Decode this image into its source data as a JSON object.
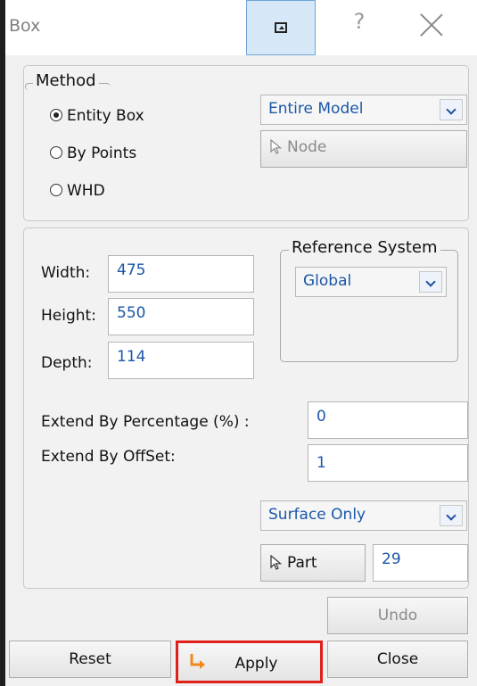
{
  "window": {
    "title": "Box",
    "help_glyph": "?"
  },
  "method": {
    "legend": "Method",
    "options": [
      "Entity Box",
      "By Points",
      "WHD"
    ],
    "selected": "Entity Box",
    "scope_combo": "Entire Model",
    "node_button": "Node"
  },
  "dimensions": {
    "width_label": "Width:",
    "width_value": "475",
    "height_label": "Height:",
    "height_value": "550",
    "depth_label": "Depth:",
    "depth_value": "114"
  },
  "reference_system": {
    "legend": "Reference System",
    "value": "Global"
  },
  "extend": {
    "percentage_label": "Extend By Percentage (%) :",
    "percentage_value": "0",
    "offset_label": "Extend By OffSet:",
    "offset_value": "1"
  },
  "surface_combo": "Surface Only",
  "part": {
    "button_label": "Part",
    "value": "29"
  },
  "actions": {
    "undo": "Undo",
    "reset": "Reset",
    "apply": "Apply",
    "close": "Close"
  },
  "colors": {
    "value_text": "#1b57a8",
    "highlight_border": "#e0201a",
    "pin_button_bg": "#d6e8f7",
    "apply_icon": "#f08a1c"
  },
  "icons": [
    "pin-window-icon",
    "help-icon",
    "close-icon",
    "cursor-arrow-icon",
    "dropdown-arrow-icon",
    "apply-arrow-icon"
  ]
}
